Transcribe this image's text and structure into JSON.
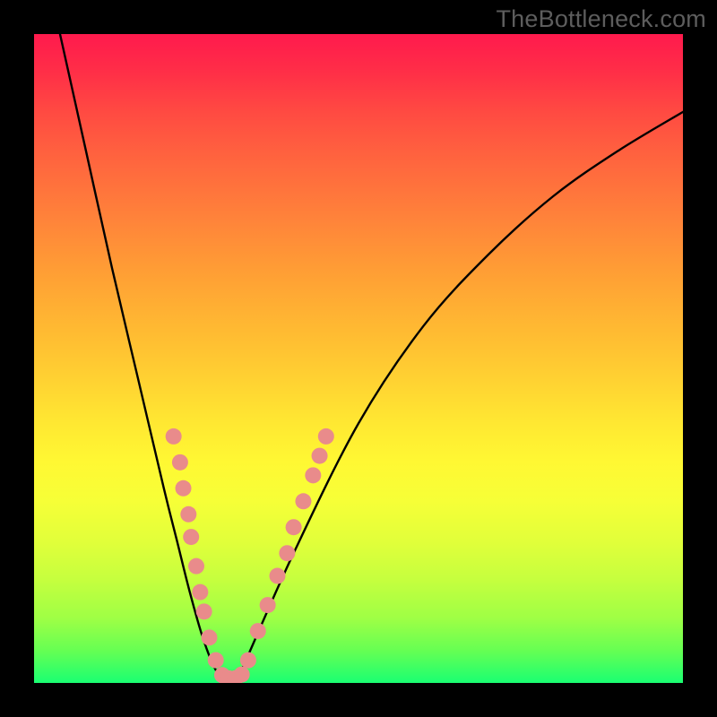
{
  "watermark": "TheBottleneck.com",
  "chart_data": {
    "type": "line",
    "title": "",
    "xlabel": "",
    "ylabel": "",
    "xlim": [
      0,
      100
    ],
    "ylim": [
      0,
      100
    ],
    "series": [
      {
        "name": "bottleneck-curve",
        "color": "#000000",
        "x": [
          4,
          8,
          12,
          16,
          20,
          22,
          24,
          26,
          28,
          30,
          31,
          32,
          40,
          50,
          60,
          70,
          80,
          90,
          100
        ],
        "y": [
          100,
          82,
          64,
          47,
          30,
          22,
          14,
          7,
          2,
          0,
          0,
          2,
          20,
          40,
          55,
          66,
          75,
          82,
          88
        ]
      }
    ],
    "markers": {
      "name": "highlight-points",
      "color": "#e98b8b",
      "radius": 9,
      "points": [
        {
          "x": 21.5,
          "y": 38
        },
        {
          "x": 22.5,
          "y": 34
        },
        {
          "x": 23.0,
          "y": 30
        },
        {
          "x": 23.8,
          "y": 26
        },
        {
          "x": 24.2,
          "y": 22.5
        },
        {
          "x": 25.0,
          "y": 18
        },
        {
          "x": 25.6,
          "y": 14
        },
        {
          "x": 26.2,
          "y": 11
        },
        {
          "x": 27.0,
          "y": 7
        },
        {
          "x": 28.0,
          "y": 3.5
        },
        {
          "x": 29.0,
          "y": 1.2
        },
        {
          "x": 30.0,
          "y": 0.7
        },
        {
          "x": 31.0,
          "y": 0.7
        },
        {
          "x": 32.0,
          "y": 1.3
        },
        {
          "x": 33.0,
          "y": 3.5
        },
        {
          "x": 34.5,
          "y": 8
        },
        {
          "x": 36.0,
          "y": 12
        },
        {
          "x": 37.5,
          "y": 16.5
        },
        {
          "x": 39.0,
          "y": 20
        },
        {
          "x": 40.0,
          "y": 24
        },
        {
          "x": 41.5,
          "y": 28
        },
        {
          "x": 43.0,
          "y": 32
        },
        {
          "x": 44.0,
          "y": 35
        },
        {
          "x": 45.0,
          "y": 38
        }
      ]
    },
    "background_gradient": {
      "top": "#ff1a4d",
      "bottom": "#1aff72"
    }
  }
}
